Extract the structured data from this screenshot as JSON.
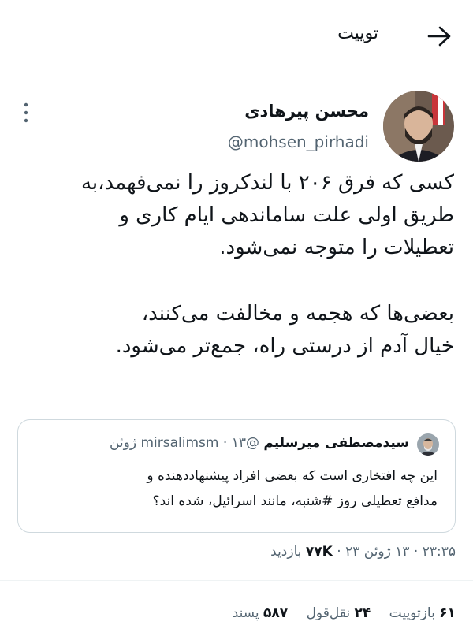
{
  "header": {
    "title": "توییت"
  },
  "author": {
    "name": "محسن پیرهادی",
    "handle": "@mohsen_pirhadi"
  },
  "tweet": {
    "lines_p1": [
      "کسی که فرق ۲۰۶ با لندکروز را نمی‌فهمد،به",
      "طریق اولی علت ساماندهی ایام کاری و",
      "تعطیلات را متوجه نمی‌شود."
    ],
    "lines_p2": [
      "بعضی‌ها که هجمه و مخالفت می‌کنند،",
      "خیال آدم از درستی راه، جمع‌تر می‌شود."
    ]
  },
  "quoted": {
    "name": "سیدمصطفی میرسلیم",
    "handle": "@mirsalimsm",
    "date": "۱۳ ژوئن",
    "separator": "·",
    "lines": [
      "این چه افتخاری است که بعضی افراد پیشنهاددهنده و",
      "مدافع تعطیلی روز #شنبه، مانند اسرائیل،  شده اند؟"
    ]
  },
  "meta": {
    "time": "۲۳:۳۵",
    "date": "۱۳ ژوئن ۲۳",
    "separator": "·",
    "views": "۷۷K",
    "views_label": "بازدید"
  },
  "stats": {
    "retweets_count": "۶۱",
    "retweets_label": "بازتوییت",
    "quotes_count": "۲۴",
    "quotes_label": "نقل‌قول",
    "likes_count": "۵۸۷",
    "likes_label": "پسند"
  },
  "colors": {
    "text": "#0f1419",
    "secondary": "#536471",
    "border": "#cfd9de",
    "divider": "#eff3f4"
  }
}
